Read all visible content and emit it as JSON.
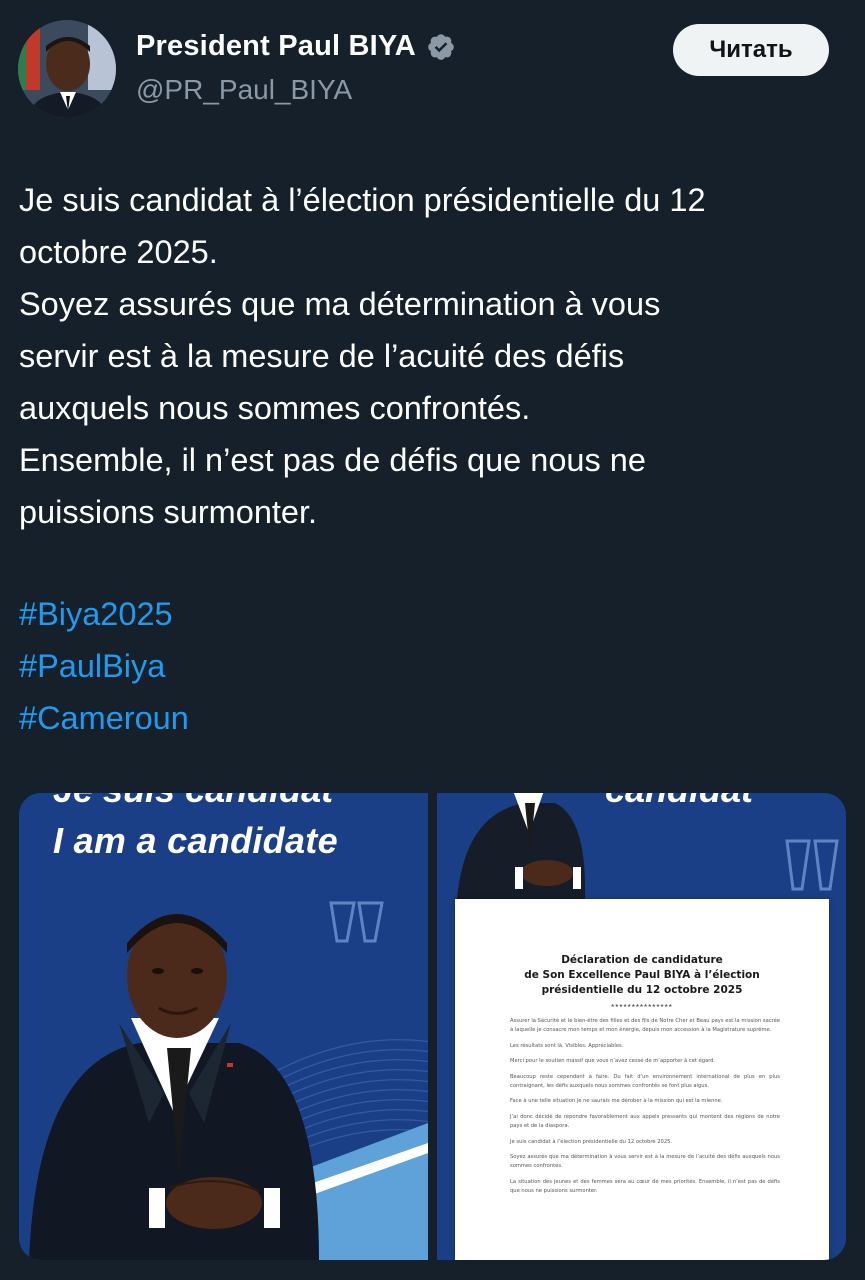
{
  "account": {
    "display_name": "President Paul BIYA",
    "handle": "@PR_Paul_BIYA",
    "verified_icon": "verified-badge-icon",
    "read_button_label": "Читать"
  },
  "tweet": {
    "lines": [
      "Je suis candidat à l’élection présidentielle du 12",
      "octobre 2025.",
      "Soyez assurés que ma détermination à vous",
      "servir est à la mesure de l’acuité des défis",
      "auxquels nous sommes confrontés.",
      "Ensemble, il n’est pas de défis que nous ne",
      "puissions surmonter."
    ],
    "hashtags": [
      "#Biya2025",
      "#PaulBiya",
      "#Cameroun"
    ]
  },
  "media": {
    "left": {
      "top_cut_text": "Je suis candidat",
      "caption": "I am a candidate"
    },
    "right": {
      "top_cut_text": "candidat",
      "doc_title": [
        "Déclaration de candidature",
        "de Son Excellence Paul BIYA à l’élection",
        "présidentielle du 12 octobre 2025"
      ],
      "doc_stars": "***************",
      "doc_paragraphs": [
        "Assurer la Sécurité et le bien-être des filles et des fils de Notre Cher et Beau pays est la mission sacrée à laquelle je consacre mon temps et mon énergie, depuis mon accession à la Magistrature suprême.",
        "Les résultats sont là. Visibles. Appréciables.",
        "Merci pour le soutien massif que vous n’avez cessé de m’apporter à cet égard.",
        "Beaucoup reste cependant à faire. Du fait d’un environnement international de plus en plus contraignant, les défis auxquels nous sommes confrontés se font plus aigus.",
        "Face à une telle situation je ne saurais me dérober à la mission qui est la mienne.",
        "J’ai donc décidé de répondre favorablement aux appels pressants qui montent des régions de notre pays et de la diaspora.",
        "Je suis candidat à l’élection présidentielle du 12 octobre 2025.",
        "Soyez assurés que ma détermination à vous servir est à la mesure de l’acuité des défis auxquels nous sommes confrontés.",
        "La situation des jeunes et des femmes sera au cœur de mes priorités. Ensemble, il n’est pas de défis que nous ne puissions surmonter."
      ]
    }
  },
  "colors": {
    "background": "#15202b",
    "link": "#1d9bf0",
    "muted": "#8b98a5",
    "poster_blue": "#1b3f86"
  }
}
